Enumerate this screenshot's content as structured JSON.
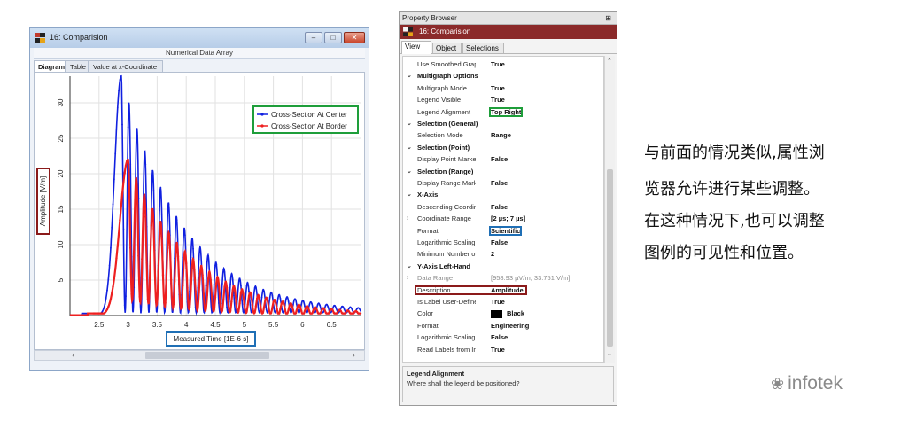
{
  "window": {
    "title": "16: Comparision",
    "caption": "Numerical Data Array",
    "controls": [
      "–",
      "□",
      "✕"
    ],
    "tabs": [
      "Diagram",
      "Table",
      "Value at x-Coordinate"
    ],
    "active_tab": "Diagram",
    "scroll_arrows": [
      "‹",
      "›"
    ]
  },
  "chart_data": {
    "type": "line",
    "xlabel": "Measured Time [1E-6 s]",
    "ylabel": "Amplitude [V/m]",
    "xlim": [
      2,
      7
    ],
    "ylim": [
      0,
      33.75
    ],
    "x_ticks": [
      "2.5",
      "3",
      "3.5",
      "4",
      "4.5",
      "5",
      "5.5",
      "6",
      "6.5"
    ],
    "y_ticks": [
      "5",
      "10",
      "15",
      "20",
      "25",
      "30"
    ],
    "grid": true,
    "legend_position": "top-right",
    "series": [
      {
        "name": "Cross-Section At Center",
        "color": "#1020e0",
        "peak_x": 2.88,
        "peak_y": 33.75,
        "description": "damped oscillation, rises sharply from ~2.5 to peak 33.75 at 2.88, oscillating decay to ~0.3 at 7"
      },
      {
        "name": "Cross-Section At Border",
        "color": "#ee2020",
        "peak_x": 3.0,
        "peak_y": 22.0,
        "description": "damped oscillation, smoother and smaller peak ~22 at 3.0, decaying to ~0.3 at 7"
      }
    ]
  },
  "annotations": {
    "legend_box_color": "#1e9e3a",
    "ylabel_box_color": "#8b1a1a",
    "xlabel_box_color": "#1f6fb5"
  },
  "property_browser": {
    "header": "Property Browser",
    "pin": "⊞",
    "document": "16: Comparision",
    "tabs": [
      "View",
      "Object",
      "Selections"
    ],
    "active_tab": "View",
    "rows": [
      {
        "kind": "prop",
        "name": "Use Smoothed Grapl",
        "value": "True"
      },
      {
        "kind": "cat",
        "name": "Multigraph Options",
        "toggle": "⌄"
      },
      {
        "kind": "prop",
        "name": "Multigraph Mode",
        "value": "True"
      },
      {
        "kind": "prop",
        "name": "Legend Visible",
        "value": "True"
      },
      {
        "kind": "prop",
        "name": "Legend Alignment",
        "value": "Top Right",
        "box": "#1e9e3a"
      },
      {
        "kind": "cat",
        "name": "Selection (General)",
        "toggle": "⌄"
      },
      {
        "kind": "prop",
        "name": "Selection Mode",
        "value": "Range"
      },
      {
        "kind": "cat",
        "name": "Selection (Point)",
        "toggle": "⌄"
      },
      {
        "kind": "prop",
        "name": "Display Point Marker",
        "value": "False"
      },
      {
        "kind": "cat",
        "name": "Selection (Range)",
        "toggle": "⌄"
      },
      {
        "kind": "prop",
        "name": "Display Range Marke",
        "value": "False"
      },
      {
        "kind": "cat",
        "name": "X-Axis",
        "toggle": "⌄"
      },
      {
        "kind": "prop",
        "name": "Descending Coordin:",
        "value": "False"
      },
      {
        "kind": "prop",
        "name": "Coordinate Range",
        "value": "[2 µs; 7 µs]",
        "toggle": "›"
      },
      {
        "kind": "prop",
        "name": "Format",
        "value": "Scientific",
        "box": "#1f6fb5"
      },
      {
        "kind": "prop",
        "name": "Logarithmic Scaling",
        "value": "False"
      },
      {
        "kind": "prop",
        "name": "Minimum Number of",
        "value": "2"
      },
      {
        "kind": "cat",
        "name": "Y-Axis Left-Hand",
        "toggle": "⌄"
      },
      {
        "kind": "prop",
        "name": "Data Range",
        "value": "[958.93 µV/m; 33.751 V/m]",
        "toggle": "›",
        "dim": true
      },
      {
        "kind": "prop",
        "name": "Description",
        "value": "Amplitude",
        "box": "#8b1a1a"
      },
      {
        "kind": "prop",
        "name": "Is Label User-Defined",
        "value": "True"
      },
      {
        "kind": "prop",
        "name": "Color",
        "value": "Black",
        "swatch": "#000000"
      },
      {
        "kind": "prop",
        "name": "Format",
        "value": "Engineering"
      },
      {
        "kind": "prop",
        "name": "Logarithmic Scaling",
        "value": "False"
      },
      {
        "kind": "prop",
        "name": "Read Labels from Ins",
        "value": "True"
      }
    ],
    "scroll_arrows": [
      "⌃",
      "⌄"
    ],
    "help": {
      "title": "Legend Alignment",
      "text": "Where shall the legend be positioned?"
    }
  },
  "side_text": [
    "与前面的情况类似,属性浏",
    "览器允许进行某些调整。",
    "在这种情况下,也可以调整",
    "图例的可见性和位置。"
  ],
  "brand": {
    "glyph": "❀",
    "text": "infotek"
  }
}
